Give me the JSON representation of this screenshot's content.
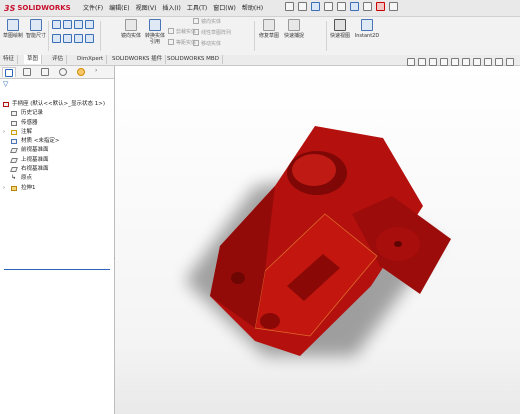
{
  "app": {
    "name": "SOLIDWORKS",
    "prefix": "3S"
  },
  "menu": [
    "文件(F)",
    "编辑(E)",
    "视图(V)",
    "插入(I)",
    "工具(T)",
    "窗口(W)",
    "帮助(H)"
  ],
  "ribbon": {
    "sketch_label": "草图绘制",
    "smart_dim_label": "智能尺寸",
    "mirror_label": "镜向实体",
    "convert_label": "转换实体引用",
    "linear_pattern_label": "线性草图阵列",
    "move_label": "移动实体",
    "repair_label": "修复草图",
    "quick_snap_label": "快速捕捉",
    "quick_view_label": "快速视图",
    "instant2d_label": "Instant2D",
    "grey1": "镜向实体",
    "grey2": "线性草图阵列",
    "grey3": "移动实体",
    "grey4": "剪裁实体",
    "grey5": "等距实体"
  },
  "tabs": [
    "特征",
    "草图",
    "评估",
    "DimXpert",
    "SOLIDWORKS 插件",
    "SOLIDWORKS MBD"
  ],
  "active_tab": "草图",
  "tree": {
    "root": "手柄座 (默认<<默认>_显示状态 1>)",
    "items": [
      "历史记录",
      "传感器",
      "注解",
      "材质 <未指定>",
      "前视基准面",
      "上视基准面",
      "右视基准面",
      "原点",
      "拉伸1"
    ]
  },
  "colors": {
    "part_red": "#b3100e",
    "accent_blue": "#2a63b8",
    "brand_red": "#c8102e"
  }
}
